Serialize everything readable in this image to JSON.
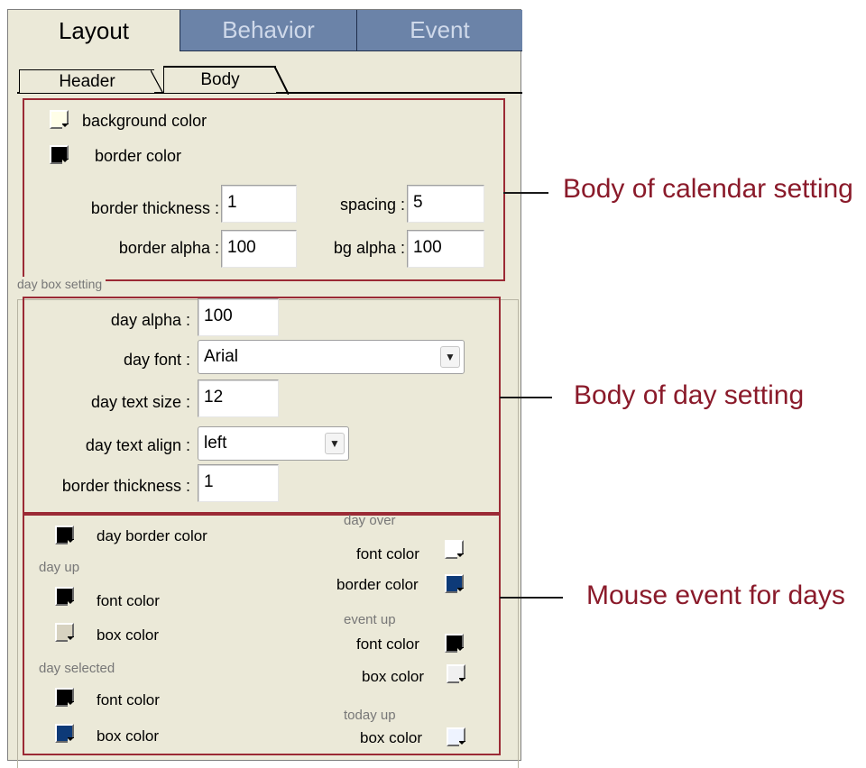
{
  "tabs": {
    "layout": "Layout",
    "behavior": "Behavior",
    "event": "Event"
  },
  "subtabs": {
    "header": "Header",
    "body": "Body"
  },
  "calendar_body": {
    "background_color_label": "background color",
    "border_color_label": "border color",
    "border_thickness_label": "border thickness :",
    "border_thickness_value": "1",
    "spacing_label": "spacing :",
    "spacing_value": "5",
    "border_alpha_label": "border alpha :",
    "border_alpha_value": "100",
    "bg_alpha_label": "bg alpha :",
    "bg_alpha_value": "100",
    "background_color": "#fffee8",
    "border_color": "#000000"
  },
  "day_box": {
    "group_title": "day box setting",
    "day_alpha_label": "day alpha :",
    "day_alpha_value": "100",
    "day_font_label": "day font :",
    "day_font_value": "Arial",
    "day_text_size_label": "day text size :",
    "day_text_size_value": "12",
    "day_text_align_label": "day text align :",
    "day_text_align_value": "left",
    "border_thickness_label": "border thickness :",
    "border_thickness_value": "1"
  },
  "mouse_events": {
    "day_border_color_label": "day border color",
    "day_up_title": "day up",
    "day_up_font_color_label": "font color",
    "day_up_box_color_label": "box color",
    "day_selected_title": "day  selected",
    "day_selected_font_color_label": "font color",
    "day_selected_box_color_label": "box color",
    "day_over_title": "day  over",
    "day_over_font_color_label": "font color",
    "day_over_border_color_label": "border color",
    "event_up_title": "event up",
    "event_up_font_color_label": "font color",
    "event_up_box_color_label": "box color",
    "today_up_title": "today up",
    "today_up_box_color_label": "box color"
  },
  "colors": {
    "black": "#000000",
    "beige": "#d7d2c0",
    "navy": "#0d3a78",
    "white": "#ffffff",
    "lightgray": "#f0f0f0",
    "lightblue": "#eef3ff"
  },
  "callouts": {
    "calendar": "Body of calendar setting",
    "day": "Body of day setting",
    "mouse": "Mouse event for days"
  }
}
